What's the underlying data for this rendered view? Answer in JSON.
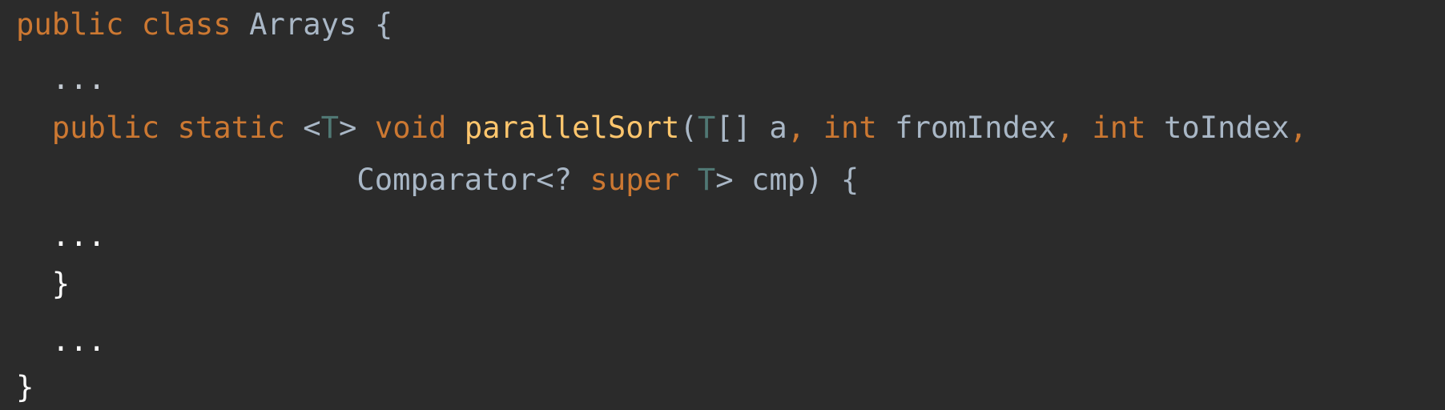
{
  "code": {
    "line1": {
      "kw_public": "public",
      "kw_class": "class",
      "class_name": "Arrays",
      "brace": "{"
    },
    "line2": {
      "ellipsis": "..."
    },
    "line3": {
      "kw_public": "public",
      "kw_static": "static",
      "generic_open": "<",
      "generic_T": "T",
      "generic_close": ">",
      "kw_void": "void",
      "method_name": "parallelSort",
      "paren_open": "(",
      "param_type": "T",
      "array_brackets": "[] a",
      "comma1": ",",
      "kw_int1": "int",
      "param_from": "fromIndex",
      "comma2": ",",
      "kw_int2": "int",
      "param_to": "toIndex",
      "comma3": ","
    },
    "line4": {
      "comparator": "Comparator<?",
      "kw_super": "super",
      "type_T": "T",
      "rest": "> cmp) {"
    },
    "line5": {
      "ellipsis": "..."
    },
    "line6": {
      "brace": "}"
    },
    "line7": {
      "ellipsis": "..."
    },
    "line8": {
      "brace": "}"
    }
  },
  "colors": {
    "background": "#2b2b2b",
    "keyword": "#cc7832",
    "type_param": "#507874",
    "method": "#ffc66d",
    "plain": "#a9b7c6"
  }
}
